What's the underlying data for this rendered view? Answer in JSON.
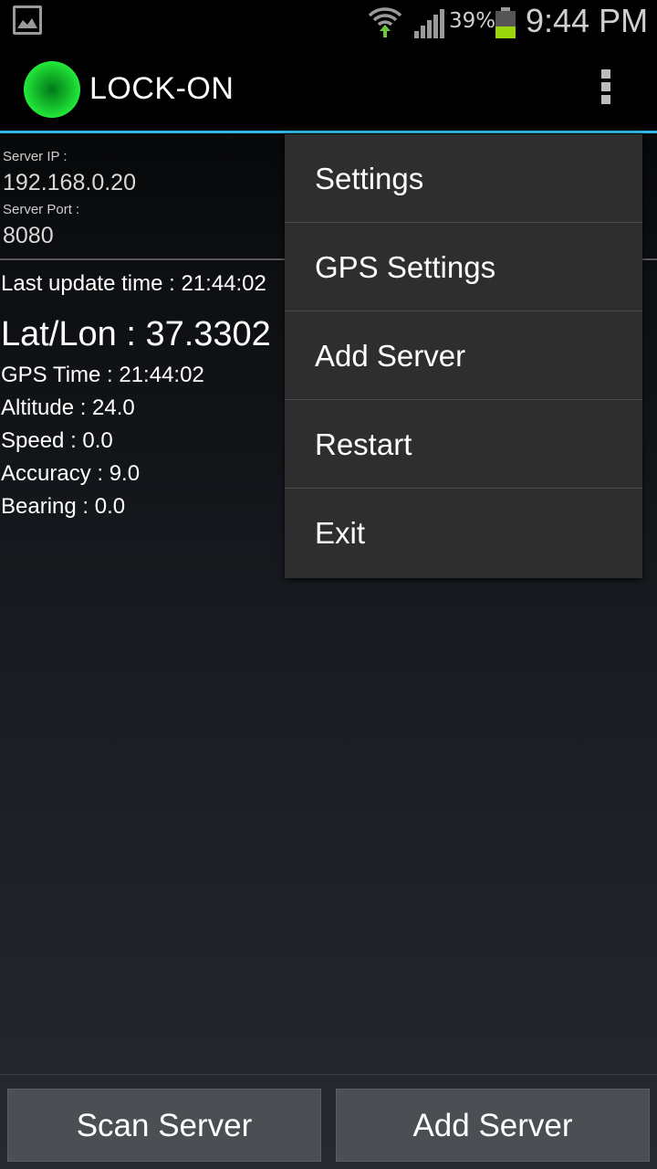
{
  "status_bar": {
    "battery_percent": "39%",
    "time": "9:44 PM",
    "icons": [
      "gallery-icon",
      "wifi-icon",
      "cell-signal-icon",
      "battery-icon"
    ],
    "battery_level": 0.39
  },
  "action_bar": {
    "title": "LOCK-ON",
    "app_icon": "green-orb-icon",
    "overflow_icon": "overflow-menu-icon"
  },
  "server": {
    "ip_label": "Server IP :",
    "ip_value": "192.168.0.20",
    "port_label": "Server Port :",
    "port_value": "8080"
  },
  "gps": {
    "last_update": "Last update time : 21:44:02",
    "latlon": "Lat/Lon : 37.3302",
    "gps_time": "GPS Time : 21:44:02",
    "altitude": "Altitude : 24.0",
    "speed": "Speed : 0.0",
    "accuracy": "Accuracy : 9.0",
    "bearing": "Bearing : 0.0"
  },
  "menu": {
    "items": [
      "Settings",
      "GPS Settings",
      "Add Server",
      "Restart",
      "Exit"
    ]
  },
  "buttons": {
    "scan": "Scan Server",
    "add": "Add Server"
  },
  "colors": {
    "accent": "#33b5e5",
    "app_icon_green": "#23e83a",
    "battery_green": "#9bd60a"
  }
}
